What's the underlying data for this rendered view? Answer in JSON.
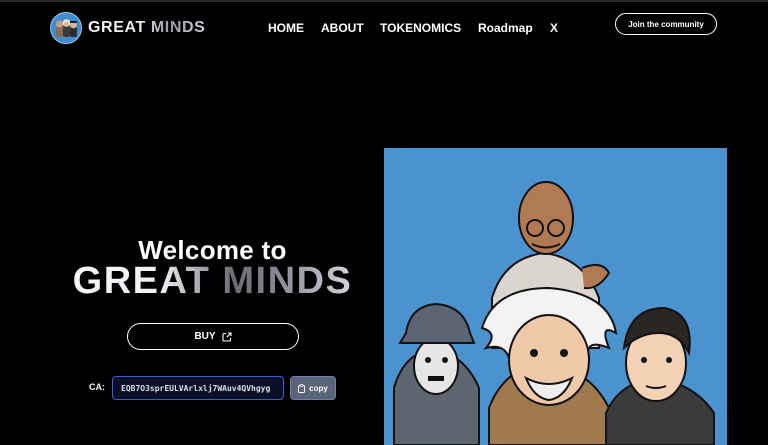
{
  "brand": {
    "name": "GREAT MINDS",
    "logo_icon": "great-minds-logo"
  },
  "nav": {
    "items": [
      {
        "label": "HOME"
      },
      {
        "label": "ABOUT"
      },
      {
        "label": "TOKENOMICS"
      },
      {
        "label": "Roadmap"
      },
      {
        "label": "X"
      }
    ],
    "cta_label": "Join the community"
  },
  "hero": {
    "welcome": "Welcome to",
    "title": "GREAT MINDS",
    "buy_label": "BUY",
    "buy_icon": "external-link-icon",
    "ca_label": "CA:",
    "ca_value": "EQB7O3sprEULVArlxlj7WAuv4QVhgyg",
    "copy_label": "copy",
    "copy_icon": "clipboard-icon"
  },
  "art": {
    "description_icon": "great-minds-characters-illustration"
  },
  "colors": {
    "background": "#000000",
    "art_background": "#4b93cf",
    "ca_border": "#3a5fd0",
    "copy_bg": "#5b6478"
  }
}
